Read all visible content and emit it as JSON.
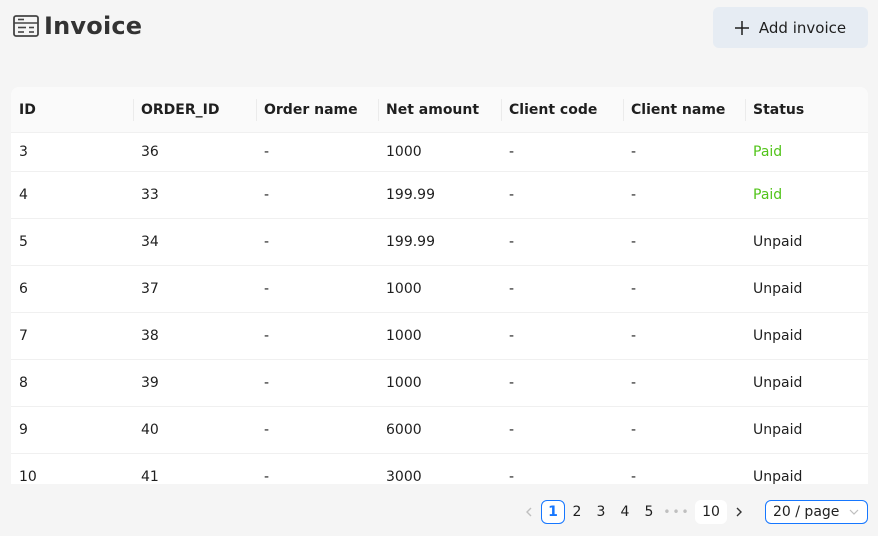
{
  "header": {
    "title": "Invoice",
    "title_icon": "invoice-list-icon",
    "add_button_label": "Add invoice",
    "add_button_icon": "plus-icon"
  },
  "table": {
    "columns": [
      "ID",
      "ORDER_ID",
      "Order name",
      "Net amount",
      "Client code",
      "Client name",
      "Status"
    ],
    "rows": [
      {
        "id": "3",
        "order_id": "36",
        "order_name": "-",
        "net_amount": "1000",
        "client_code": "-",
        "client_name": "-",
        "status": "Paid"
      },
      {
        "id": "4",
        "order_id": "33",
        "order_name": "-",
        "net_amount": "199.99",
        "client_code": "-",
        "client_name": "-",
        "status": "Paid"
      },
      {
        "id": "5",
        "order_id": "34",
        "order_name": "-",
        "net_amount": "199.99",
        "client_code": "-",
        "client_name": "-",
        "status": "Unpaid"
      },
      {
        "id": "6",
        "order_id": "37",
        "order_name": "-",
        "net_amount": "1000",
        "client_code": "-",
        "client_name": "-",
        "status": "Unpaid"
      },
      {
        "id": "7",
        "order_id": "38",
        "order_name": "-",
        "net_amount": "1000",
        "client_code": "-",
        "client_name": "-",
        "status": "Unpaid"
      },
      {
        "id": "8",
        "order_id": "39",
        "order_name": "-",
        "net_amount": "1000",
        "client_code": "-",
        "client_name": "-",
        "status": "Unpaid"
      },
      {
        "id": "9",
        "order_id": "40",
        "order_name": "-",
        "net_amount": "6000",
        "client_code": "-",
        "client_name": "-",
        "status": "Unpaid"
      },
      {
        "id": "10",
        "order_id": "41",
        "order_name": "-",
        "net_amount": "3000",
        "client_code": "-",
        "client_name": "-",
        "status": "Unpaid"
      }
    ]
  },
  "pagination": {
    "prev_icon": "chevron-left-icon",
    "next_icon": "chevron-right-icon",
    "pages": [
      "1",
      "2",
      "3",
      "4",
      "5"
    ],
    "current": "1",
    "ellipsis": "•••",
    "last_page": "10",
    "page_size": "20 / page"
  },
  "colors": {
    "paid": "#52c41a",
    "accent": "#1677ff",
    "add_button_bg": "#e6ecf3"
  }
}
